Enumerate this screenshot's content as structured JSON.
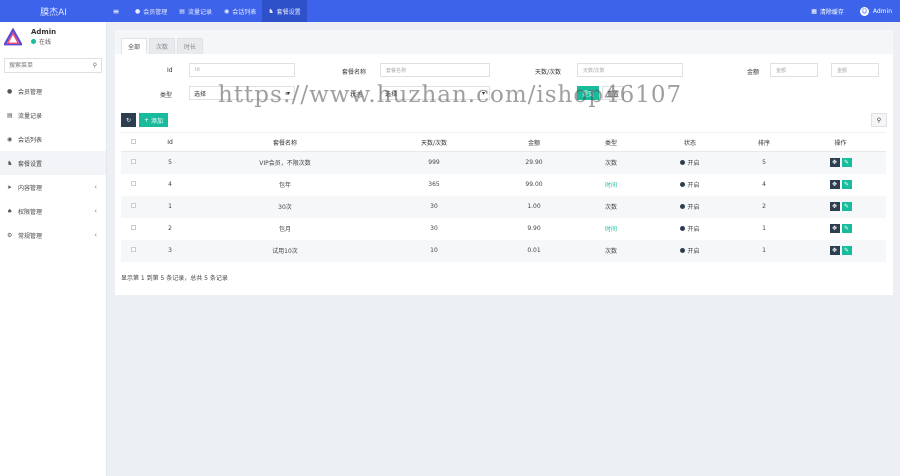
{
  "app": {
    "logo_text": "膜杰AI"
  },
  "topnav": {
    "menu_icon": "menu-icon",
    "items": [
      {
        "label": "会员管理",
        "icon": "user-icon"
      },
      {
        "label": "流量记录",
        "icon": "database-icon"
      },
      {
        "label": "会话列表",
        "icon": "chat-icon"
      },
      {
        "label": "套餐设置",
        "icon": "users-icon",
        "active": true
      }
    ],
    "right": [
      {
        "label": "清除缓存",
        "icon": "trash-icon"
      },
      {
        "label": "Admin",
        "icon": "avatar-icon"
      }
    ]
  },
  "sidebar": {
    "user": {
      "name": "Admin",
      "status": "在线"
    },
    "search_placeholder": "搜索菜单",
    "items": [
      {
        "label": "会员管理",
        "icon": "user-icon"
      },
      {
        "label": "流量记录",
        "icon": "database-icon"
      },
      {
        "label": "会话列表",
        "icon": "chat-icon"
      },
      {
        "label": "套餐设置",
        "icon": "users-icon",
        "active": true
      },
      {
        "label": "内容管理",
        "icon": "send-icon",
        "expandable": true
      },
      {
        "label": "权限管理",
        "icon": "group-icon",
        "expandable": true
      },
      {
        "label": "常规管理",
        "icon": "settings-icon",
        "expandable": true
      }
    ]
  },
  "tabs": [
    "全部",
    "次数",
    "时长"
  ],
  "filters": {
    "id_label": "Id",
    "id_placeholder": "Id",
    "name_label": "套餐名称",
    "name_placeholder": "套餐名称",
    "days_label": "天数/次数",
    "days_placeholder": "天数/次数",
    "amount_label": "金额",
    "amount_min_placeholder": "金额",
    "amount_max_placeholder": "金额",
    "type_label": "类型",
    "type_value": "选择",
    "status_label": "状态",
    "status_value": "选择",
    "submit_label": "提交",
    "reset_label": "重置"
  },
  "toolbar": {
    "add_label": "添加"
  },
  "table": {
    "headers": [
      "Id",
      "套餐名称",
      "天数/次数",
      "金额",
      "类型",
      "状态",
      "排序",
      "操作"
    ],
    "rows": [
      {
        "id": "5",
        "name": "VIP会员，不限次数",
        "days": "999",
        "amount": "29.90",
        "type": "次数",
        "status": "开启",
        "sort": "5"
      },
      {
        "id": "4",
        "name": "包年",
        "days": "365",
        "amount": "99.00",
        "type": "时间",
        "status": "开启",
        "sort": "4"
      },
      {
        "id": "1",
        "name": "30次",
        "days": "30",
        "amount": "1.00",
        "type": "次数",
        "status": "开启",
        "sort": "2"
      },
      {
        "id": "2",
        "name": "包月",
        "days": "30",
        "amount": "9.90",
        "type": "时间",
        "status": "开启",
        "sort": "1"
      },
      {
        "id": "3",
        "name": "试用10次",
        "days": "10",
        "amount": "0.01",
        "type": "次数",
        "status": "开启",
        "sort": "1"
      }
    ]
  },
  "pager": {
    "info": "显示第 1 到第 5 条记录，总共 5 条记录"
  },
  "watermark": "https://www.huzhan.com/ishop46107",
  "colors": {
    "primary": "#3c63e9",
    "success": "#18bc9c",
    "dark": "#2c3e50"
  }
}
